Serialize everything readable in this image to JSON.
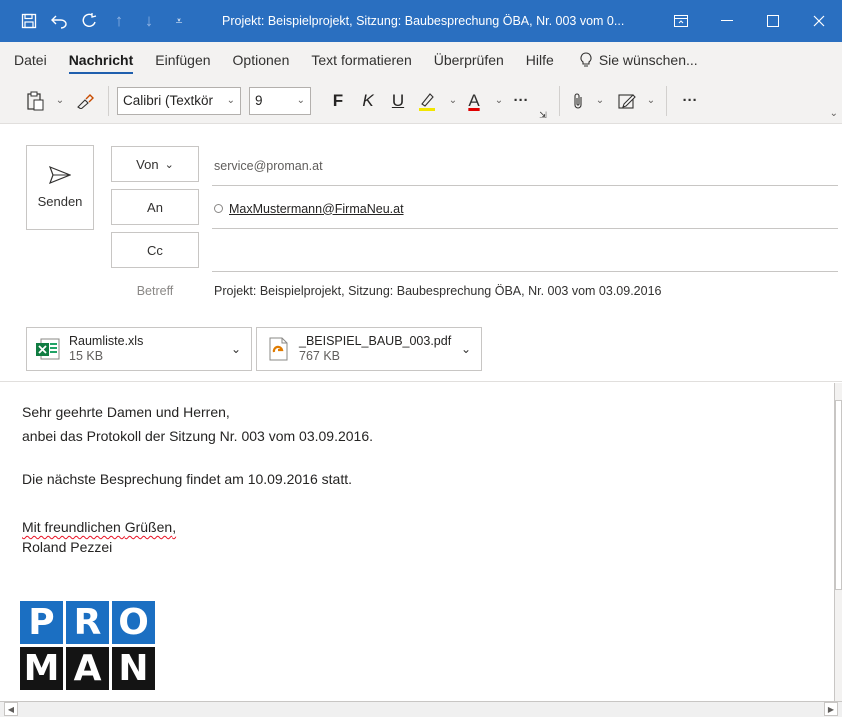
{
  "window": {
    "title": "Projekt: Beispielprojekt, Sitzung: Baubesprechung ÖBA, Nr. 003 vom 0...",
    "accent_color": "#2a6fc0"
  },
  "ribbon": {
    "tabs": [
      "Datei",
      "Nachricht",
      "Einfügen",
      "Optionen",
      "Text formatieren",
      "Überprüfen",
      "Hilfe"
    ],
    "active_tab": "Nachricht",
    "tell_me": "Sie wünschen...",
    "font_name": "Calibri (Textkör",
    "font_size": "9",
    "bold": "F",
    "italic": "K",
    "underline": "U",
    "more": "···",
    "text_color": "A"
  },
  "header": {
    "send_label": "Senden",
    "from_label": "Von",
    "from_value": "service@proman.at",
    "to_label": "An",
    "to_value": "MaxMustermann@FirmaNeu.at",
    "cc_label": "Cc",
    "subject_label": "Betreff",
    "subject_value": "Projekt: Beispielprojekt, Sitzung: Baubesprechung ÖBA, Nr. 003 vom 03.09.2016"
  },
  "attachments": [
    {
      "name": "Raumliste.xls",
      "size": "15 KB",
      "icon": "excel-file-icon"
    },
    {
      "name": "_BEISPIEL_BAUB_003.pdf",
      "size": "767 KB",
      "icon": "pdf-file-icon"
    }
  ],
  "body": {
    "line1": "Sehr geehrte Damen und Herren,",
    "line2": "anbei das Protokoll der Sitzung Nr. 003 vom 03.09.2016.",
    "line3": "Die nächste Besprechung findet am 10.09.2016 statt.",
    "closing_a": "Mit freundlichen ",
    "closing_b": "Grüßen",
    "closing_c": ",",
    "signature": "Roland Pezzei"
  },
  "logo": {
    "top": [
      "P",
      "R",
      "O"
    ],
    "bottom": [
      "M",
      "A",
      "N"
    ]
  }
}
